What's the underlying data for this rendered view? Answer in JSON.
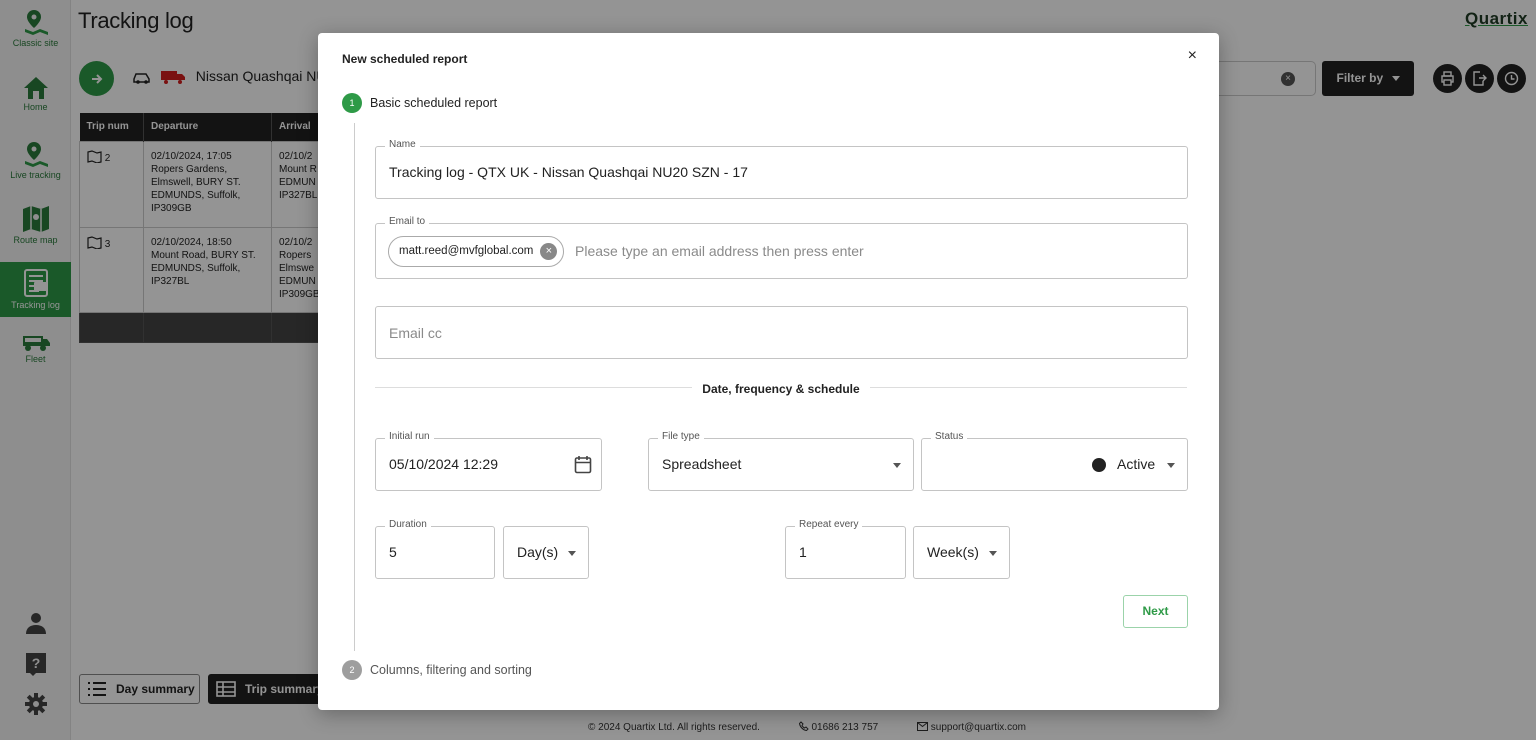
{
  "sidebar": {
    "items": [
      {
        "label": "Classic site",
        "icon": "map-pin-icon"
      },
      {
        "label": "Home",
        "icon": "home-icon"
      },
      {
        "label": "Live tracking",
        "icon": "live-tracking-icon"
      },
      {
        "label": "Route map",
        "icon": "map-icon"
      },
      {
        "label": "Tracking log",
        "icon": "tracking-log-icon",
        "active": true
      },
      {
        "label": "Fleet",
        "icon": "fleet-icon"
      }
    ],
    "bottom_icons": [
      "user-icon",
      "help-icon",
      "settings-icon"
    ]
  },
  "page": {
    "title": "Tracking log",
    "brand": "Quartix",
    "vehicle": "Nissan Quashqai NU",
    "filter_label": "Filter by",
    "table": {
      "headers": [
        "Trip num",
        "Departure",
        "Arrival"
      ],
      "rows": [
        {
          "trip": "2",
          "departure": "02/10/2024, 17:05\nRopers Gardens,\nElmswell, BURY ST.\nEDMUNDS, Suffolk,\nIP309GB",
          "arrival": "02/10/2\nMount R\nEDMUN\nIP327BL"
        },
        {
          "trip": "3",
          "departure": "02/10/2024, 18:50\nMount Road, BURY ST.\nEDMUNDS, Suffolk,\nIP327BL",
          "arrival": "02/10/2\nRopers\nElmswe\nEDMUN\nIP309GB"
        }
      ]
    },
    "day_summary": "Day summary",
    "trip_summary": "Trip summary",
    "footer": {
      "copyright": "2024 Quartix Ltd. All rights reserved.",
      "phone": "01686 213 757",
      "email": "support@quartix.com"
    }
  },
  "modal": {
    "title": "New scheduled report",
    "close": "×",
    "step1": {
      "number": "1",
      "label": "Basic scheduled report"
    },
    "step2": {
      "number": "2",
      "label": "Columns, filtering and sorting"
    },
    "name": {
      "label": "Name",
      "value": "Tracking log - QTX UK - Nissan Quashqai NU20 SZN - 17"
    },
    "email_to": {
      "label": "Email to",
      "chip": "matt.reed@mvfglobal.com",
      "placeholder": "Please type an email address then press enter"
    },
    "email_cc": {
      "placeholder": "Email cc"
    },
    "section_title": "Date, frequency & schedule",
    "initial_run": {
      "label": "Initial run",
      "value": "05/10/2024 12:29"
    },
    "file_type": {
      "label": "File type",
      "value": "Spreadsheet"
    },
    "status": {
      "label": "Status",
      "value": "Active"
    },
    "duration": {
      "label": "Duration",
      "value": "5",
      "unit": "Day(s)"
    },
    "repeat_every": {
      "label": "Repeat every",
      "value": "1",
      "unit": "Week(s)"
    },
    "next_label": "Next"
  },
  "colors": {
    "accent": "#2e9a47",
    "dark": "#222222"
  }
}
